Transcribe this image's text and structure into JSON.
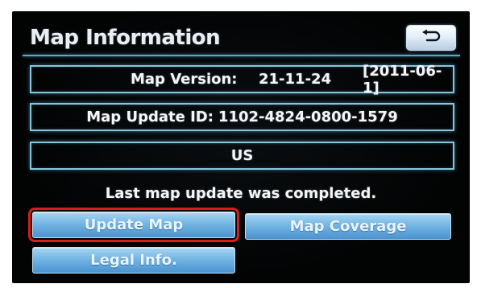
{
  "screen": {
    "title": "Map Information",
    "back_icon": "return-arrow-icon"
  },
  "info": {
    "map_version_label": "Map Version:",
    "map_version_value": "21-11-24",
    "map_version_date": "[2011-06-1]",
    "update_id_label": "Map Update ID:",
    "update_id_value": "1102-4824-0800-1579",
    "region": "US"
  },
  "status": {
    "message": "Last map update was completed."
  },
  "buttons": {
    "update_map": "Update Map",
    "map_coverage": "Map Coverage",
    "legal_info": "Legal Info."
  },
  "colors": {
    "panel_background": "#020303",
    "frame_glow": "#86c5dc",
    "button_blue": "#74b6e3",
    "highlight_red": "#d91c1c"
  }
}
